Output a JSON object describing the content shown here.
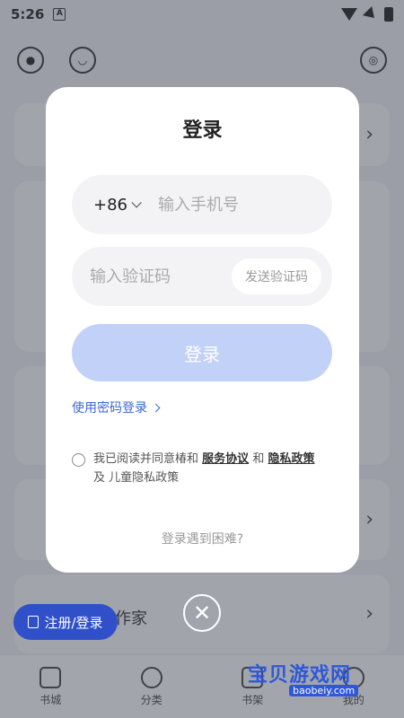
{
  "status": {
    "time": "5:26",
    "a_icon": "A"
  },
  "app": {
    "author_label": "作家",
    "register_button": "注册/登录",
    "tabs": [
      {
        "label": "书城",
        "icon": "book-icon"
      },
      {
        "label": "分类",
        "icon": "compass-icon"
      },
      {
        "label": "书架",
        "icon": "shelf-icon"
      },
      {
        "label": "我的",
        "icon": "profile-icon"
      }
    ]
  },
  "modal": {
    "title": "登录",
    "country_code": "+86",
    "phone_placeholder": "输入手机号",
    "code_placeholder": "输入验证码",
    "send_code": "发送验证码",
    "login_button": "登录",
    "password_login": "使用密码登录",
    "agreement_prefix": "我已阅读并同意椿和",
    "service_agreement": "服务协议",
    "and": "和",
    "privacy_policy": "隐私政策",
    "and2": "及",
    "children_privacy": "儿童隐私政策",
    "trouble": "登录遇到困难?"
  },
  "watermark": {
    "text": "宝贝游戏网",
    "url": "baobeiy.com"
  },
  "colors": {
    "primary": "#2f50c9",
    "login_disabled": "#c2d1f7",
    "link": "#3b66d8"
  }
}
